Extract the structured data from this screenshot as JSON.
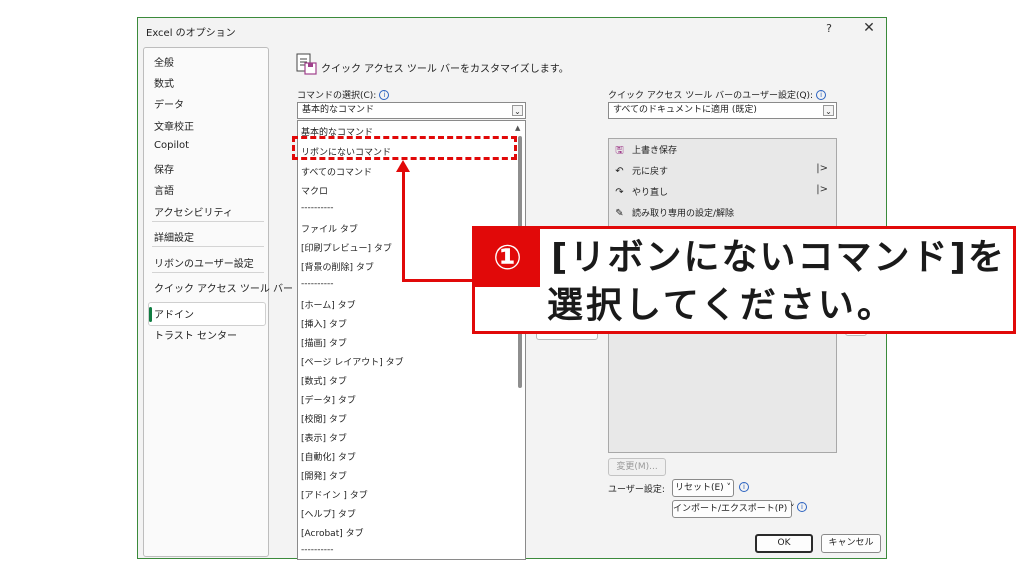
{
  "window": {
    "title": "Excel のオプション",
    "help": "?",
    "close": "✕"
  },
  "sidebar": {
    "items": [
      {
        "label": "全般"
      },
      {
        "label": "数式"
      },
      {
        "label": "データ"
      },
      {
        "label": "文章校正"
      },
      {
        "label": "Copilot"
      },
      {
        "label": "保存"
      },
      {
        "label": "言語"
      },
      {
        "label": "アクセシビリティ"
      },
      {
        "label": "詳細設定"
      },
      {
        "label": "リボンのユーザー設定"
      },
      {
        "label": "クイック アクセス ツール バー"
      },
      {
        "label": "アドイン"
      },
      {
        "label": "トラスト センター"
      }
    ],
    "selected": "クイック アクセス ツール バー"
  },
  "main": {
    "header": "クイック アクセス ツール バーをカスタマイズします。",
    "choose_label": "コマンドの選択(C):",
    "choose_value": "基本的なコマンド",
    "customize_label": "クイック アクセス ツール バーのユーザー設定(Q):",
    "customize_value": "すべてのドキュメントに適用 (既定)",
    "left_list": [
      "基本的なコマンド",
      "リボンにないコマンド",
      "すべてのコマンド",
      "マクロ",
      "----------",
      "ファイル タブ",
      "[印刷プレビュー] タブ",
      "[背景の削除] タブ",
      "----------",
      "[ホーム] タブ",
      "[挿入] タブ",
      "[描画] タブ",
      "[ページ レイアウト] タブ",
      "[数式] タブ",
      "[データ] タブ",
      "[校閲] タブ",
      "[表示] タブ",
      "[自動化] タブ",
      "[開発] タブ",
      "[アドイン ] タブ",
      "[ヘルプ] タブ",
      "[Acrobat] タブ",
      "----------"
    ],
    "right_list": [
      {
        "label": "上書き保存",
        "icon": "save-icon",
        "glyph": "🖫",
        "sub": ""
      },
      {
        "label": "元に戻す",
        "icon": "undo-icon",
        "glyph": "↶",
        "sub": "|>"
      },
      {
        "label": "やり直し",
        "icon": "redo-icon",
        "glyph": "↷",
        "sub": "|>"
      },
      {
        "label": "読み取り専用の設定/解除",
        "icon": "edit-readonly-icon",
        "glyph": "✎",
        "sub": ""
      }
    ],
    "modify_button": "変更(M)...",
    "user_settings_label": "ユーザー設定:",
    "reset_button": "リセット(E) ˅",
    "import_export_button": "インポート/エクスポート(P) ˅",
    "info_glyph": "i"
  },
  "footer": {
    "ok": "OK",
    "cancel": "キャンセル"
  },
  "callout": {
    "number": "①",
    "line1": "[リボンにないコマンド]を",
    "line2": "選択してください。"
  },
  "colors": {
    "accent": "#107c41",
    "highlight": "#e10909"
  }
}
